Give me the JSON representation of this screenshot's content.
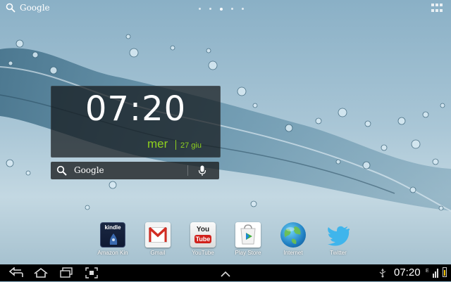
{
  "top_search": {
    "label": "Google"
  },
  "home_pages": {
    "count": 5,
    "active_index": 2
  },
  "clock": {
    "time": "07:20",
    "day": "mer",
    "date": "27 giu"
  },
  "search_widget": {
    "label": "Google"
  },
  "apps": [
    {
      "label": "Amazon Kin",
      "icon": "kindle-icon"
    },
    {
      "label": "Gmail",
      "icon": "gmail-icon"
    },
    {
      "label": "YouTube",
      "icon": "youtube-icon"
    },
    {
      "label": "Play Store",
      "icon": "play-store-icon"
    },
    {
      "label": "Internet",
      "icon": "globe-icon"
    },
    {
      "label": "Twitter",
      "icon": "twitter-bird-icon"
    }
  ],
  "app_icon_text": {
    "kindle": "kindle",
    "you": "You",
    "tube": "Tube"
  },
  "status_bar": {
    "time": "07:20",
    "network": "E"
  },
  "colors": {
    "clock_accent": "#8fd11e",
    "navbar": "#000000",
    "battery": "#f5c400"
  }
}
